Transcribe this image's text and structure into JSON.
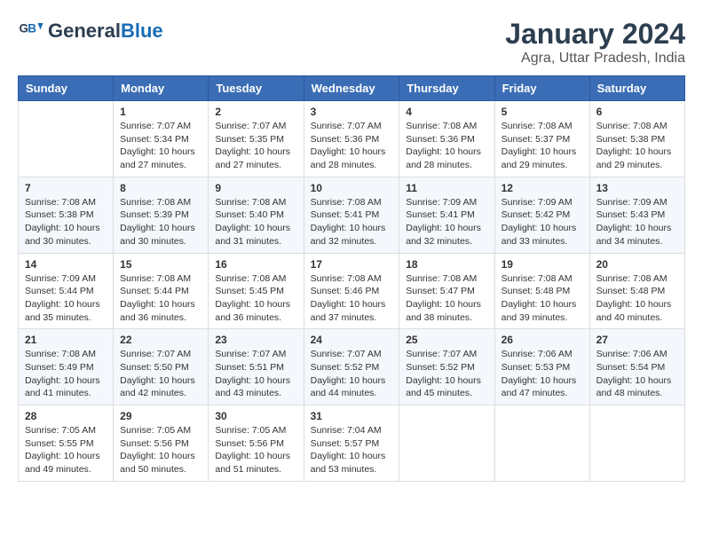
{
  "header": {
    "logo_line1": "General",
    "logo_line2": "Blue",
    "main_title": "January 2024",
    "subtitle": "Agra, Uttar Pradesh, India"
  },
  "calendar": {
    "days_of_week": [
      "Sunday",
      "Monday",
      "Tuesday",
      "Wednesday",
      "Thursday",
      "Friday",
      "Saturday"
    ],
    "weeks": [
      [
        {
          "day": "",
          "content": ""
        },
        {
          "day": "1",
          "content": "Sunrise: 7:07 AM\nSunset: 5:34 PM\nDaylight: 10 hours\nand 27 minutes."
        },
        {
          "day": "2",
          "content": "Sunrise: 7:07 AM\nSunset: 5:35 PM\nDaylight: 10 hours\nand 27 minutes."
        },
        {
          "day": "3",
          "content": "Sunrise: 7:07 AM\nSunset: 5:36 PM\nDaylight: 10 hours\nand 28 minutes."
        },
        {
          "day": "4",
          "content": "Sunrise: 7:08 AM\nSunset: 5:36 PM\nDaylight: 10 hours\nand 28 minutes."
        },
        {
          "day": "5",
          "content": "Sunrise: 7:08 AM\nSunset: 5:37 PM\nDaylight: 10 hours\nand 29 minutes."
        },
        {
          "day": "6",
          "content": "Sunrise: 7:08 AM\nSunset: 5:38 PM\nDaylight: 10 hours\nand 29 minutes."
        }
      ],
      [
        {
          "day": "7",
          "content": "Sunrise: 7:08 AM\nSunset: 5:38 PM\nDaylight: 10 hours\nand 30 minutes."
        },
        {
          "day": "8",
          "content": "Sunrise: 7:08 AM\nSunset: 5:39 PM\nDaylight: 10 hours\nand 30 minutes."
        },
        {
          "day": "9",
          "content": "Sunrise: 7:08 AM\nSunset: 5:40 PM\nDaylight: 10 hours\nand 31 minutes."
        },
        {
          "day": "10",
          "content": "Sunrise: 7:08 AM\nSunset: 5:41 PM\nDaylight: 10 hours\nand 32 minutes."
        },
        {
          "day": "11",
          "content": "Sunrise: 7:09 AM\nSunset: 5:41 PM\nDaylight: 10 hours\nand 32 minutes."
        },
        {
          "day": "12",
          "content": "Sunrise: 7:09 AM\nSunset: 5:42 PM\nDaylight: 10 hours\nand 33 minutes."
        },
        {
          "day": "13",
          "content": "Sunrise: 7:09 AM\nSunset: 5:43 PM\nDaylight: 10 hours\nand 34 minutes."
        }
      ],
      [
        {
          "day": "14",
          "content": "Sunrise: 7:09 AM\nSunset: 5:44 PM\nDaylight: 10 hours\nand 35 minutes."
        },
        {
          "day": "15",
          "content": "Sunrise: 7:08 AM\nSunset: 5:44 PM\nDaylight: 10 hours\nand 36 minutes."
        },
        {
          "day": "16",
          "content": "Sunrise: 7:08 AM\nSunset: 5:45 PM\nDaylight: 10 hours\nand 36 minutes."
        },
        {
          "day": "17",
          "content": "Sunrise: 7:08 AM\nSunset: 5:46 PM\nDaylight: 10 hours\nand 37 minutes."
        },
        {
          "day": "18",
          "content": "Sunrise: 7:08 AM\nSunset: 5:47 PM\nDaylight: 10 hours\nand 38 minutes."
        },
        {
          "day": "19",
          "content": "Sunrise: 7:08 AM\nSunset: 5:48 PM\nDaylight: 10 hours\nand 39 minutes."
        },
        {
          "day": "20",
          "content": "Sunrise: 7:08 AM\nSunset: 5:48 PM\nDaylight: 10 hours\nand 40 minutes."
        }
      ],
      [
        {
          "day": "21",
          "content": "Sunrise: 7:08 AM\nSunset: 5:49 PM\nDaylight: 10 hours\nand 41 minutes."
        },
        {
          "day": "22",
          "content": "Sunrise: 7:07 AM\nSunset: 5:50 PM\nDaylight: 10 hours\nand 42 minutes."
        },
        {
          "day": "23",
          "content": "Sunrise: 7:07 AM\nSunset: 5:51 PM\nDaylight: 10 hours\nand 43 minutes."
        },
        {
          "day": "24",
          "content": "Sunrise: 7:07 AM\nSunset: 5:52 PM\nDaylight: 10 hours\nand 44 minutes."
        },
        {
          "day": "25",
          "content": "Sunrise: 7:07 AM\nSunset: 5:52 PM\nDaylight: 10 hours\nand 45 minutes."
        },
        {
          "day": "26",
          "content": "Sunrise: 7:06 AM\nSunset: 5:53 PM\nDaylight: 10 hours\nand 47 minutes."
        },
        {
          "day": "27",
          "content": "Sunrise: 7:06 AM\nSunset: 5:54 PM\nDaylight: 10 hours\nand 48 minutes."
        }
      ],
      [
        {
          "day": "28",
          "content": "Sunrise: 7:05 AM\nSunset: 5:55 PM\nDaylight: 10 hours\nand 49 minutes."
        },
        {
          "day": "29",
          "content": "Sunrise: 7:05 AM\nSunset: 5:56 PM\nDaylight: 10 hours\nand 50 minutes."
        },
        {
          "day": "30",
          "content": "Sunrise: 7:05 AM\nSunset: 5:56 PM\nDaylight: 10 hours\nand 51 minutes."
        },
        {
          "day": "31",
          "content": "Sunrise: 7:04 AM\nSunset: 5:57 PM\nDaylight: 10 hours\nand 53 minutes."
        },
        {
          "day": "",
          "content": ""
        },
        {
          "day": "",
          "content": ""
        },
        {
          "day": "",
          "content": ""
        }
      ]
    ]
  }
}
